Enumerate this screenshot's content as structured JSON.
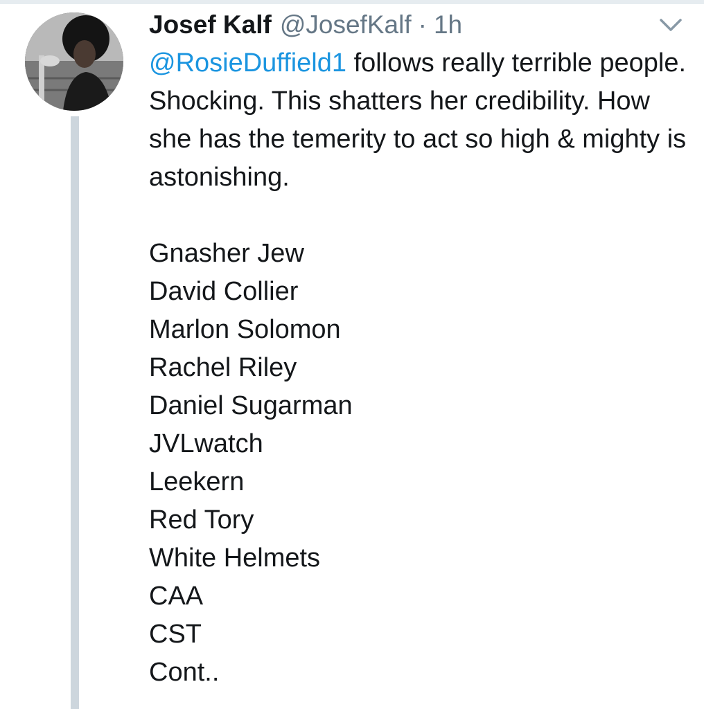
{
  "tweet": {
    "author": {
      "display_name": "Josef Kalf",
      "handle": "@JosefKalf"
    },
    "separator": "·",
    "time": "1h",
    "mention": "@RosieDuffield1",
    "text": " follows really terrible people. Shocking. This shatters her credibility. How she has the temerity to act so high & mighty is astonishing.",
    "list": [
      "Gnasher Jew",
      "David Collier",
      "Marlon Solomon",
      "Rachel Riley",
      "Daniel Sugarman",
      "JVLwatch",
      "Leekern",
      "Red Tory",
      "White Helmets",
      "CAA",
      "CST",
      "Cont.."
    ]
  },
  "icons": {
    "menu": "chevron-down-icon",
    "avatar": "profile-avatar"
  },
  "colors": {
    "mention": "#1b95e0",
    "secondary_text": "#657786",
    "thread_line": "#cdd6dd",
    "text": "#14171a"
  }
}
